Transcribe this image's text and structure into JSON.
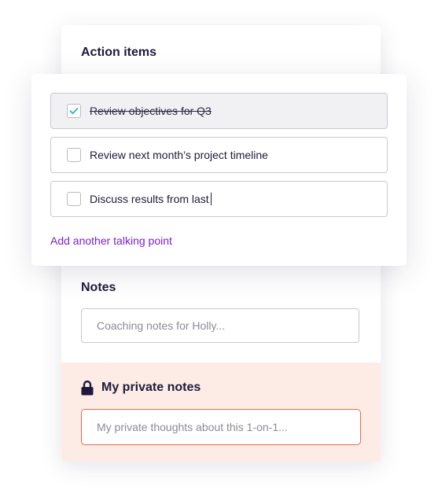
{
  "action_items": {
    "heading": "Action items",
    "items": [
      {
        "label": "Review objectives for Q3",
        "checked": true
      },
      {
        "label": "Review next month’s project timeline",
        "checked": false
      },
      {
        "label": "Discuss results from last",
        "checked": false
      }
    ],
    "add_link": "Add another talking point"
  },
  "notes": {
    "heading": "Notes",
    "placeholder": "Coaching notes for Holly..."
  },
  "private_notes": {
    "heading": "My private notes",
    "icon": "lock-icon",
    "placeholder": "My private thoughts about this 1-on-1..."
  },
  "colors": {
    "link": "#7a1fd1",
    "check": "#2bb3c0",
    "private_bg": "#fdece6",
    "private_border": "#e46a47"
  }
}
